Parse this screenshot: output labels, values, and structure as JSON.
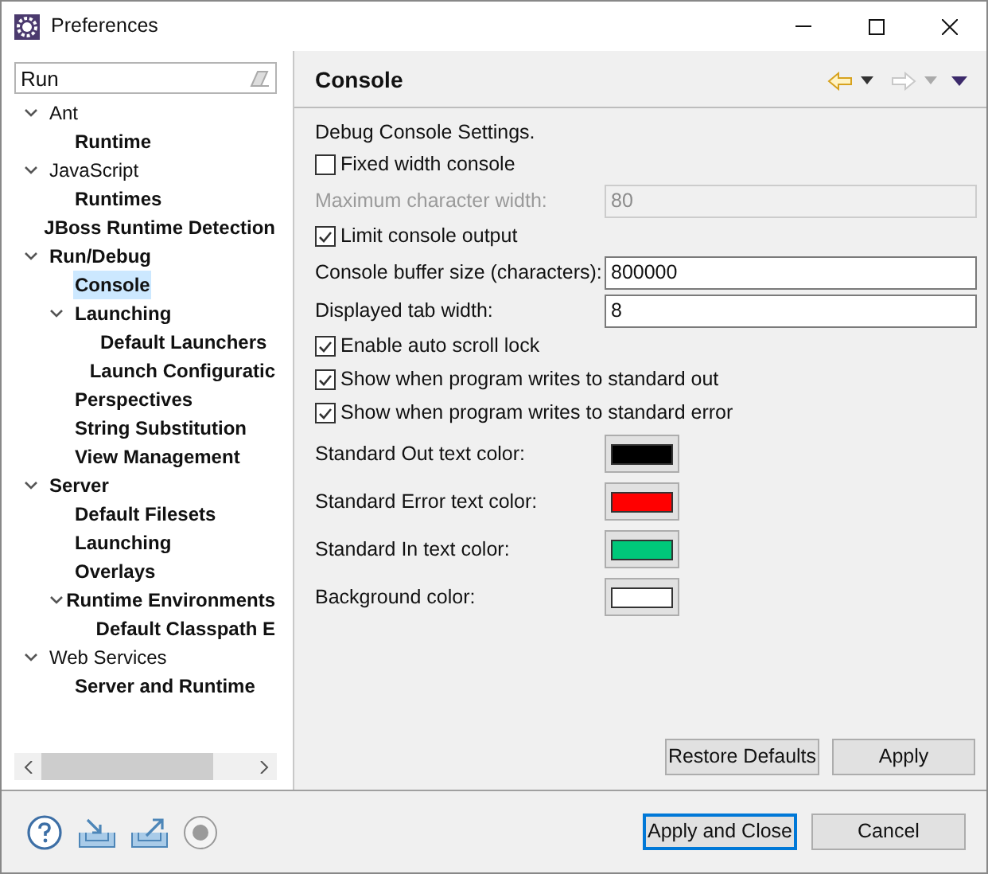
{
  "window": {
    "title": "Preferences"
  },
  "filter": {
    "value": "Run"
  },
  "tree": [
    {
      "label": "Ant",
      "matched": false,
      "selected": false,
      "expanded": true,
      "children": [
        {
          "label": "Runtime",
          "matched": true,
          "selected": false
        }
      ]
    },
    {
      "label": "JavaScript",
      "matched": false,
      "selected": false,
      "expanded": true,
      "children": [
        {
          "label": "Runtimes",
          "matched": true,
          "selected": false
        }
      ]
    },
    {
      "label": "JBoss Runtime Detection",
      "matched": true,
      "selected": false
    },
    {
      "label": "Run/Debug",
      "matched": true,
      "selected": false,
      "expanded": true,
      "children": [
        {
          "label": "Console",
          "matched": true,
          "selected": true
        },
        {
          "label": "Launching",
          "matched": true,
          "selected": false,
          "expanded": true,
          "children": [
            {
              "label": "Default Launchers",
              "matched": true,
              "selected": false
            },
            {
              "label": "Launch Configuratic",
              "matched": true,
              "selected": false
            }
          ]
        },
        {
          "label": "Perspectives",
          "matched": true,
          "selected": false
        },
        {
          "label": "String Substitution",
          "matched": true,
          "selected": false
        },
        {
          "label": "View Management",
          "matched": true,
          "selected": false
        }
      ]
    },
    {
      "label": "Server",
      "matched": true,
      "selected": false,
      "expanded": true,
      "children": [
        {
          "label": "Default Filesets",
          "matched": true,
          "selected": false
        },
        {
          "label": "Launching",
          "matched": true,
          "selected": false
        },
        {
          "label": "Overlays",
          "matched": true,
          "selected": false
        },
        {
          "label": "Runtime Environments",
          "matched": true,
          "selected": false,
          "expanded": true,
          "children": [
            {
              "label": "Default Classpath E",
              "matched": true,
              "selected": false
            }
          ]
        }
      ]
    },
    {
      "label": "Web Services",
      "matched": false,
      "selected": false,
      "expanded": true,
      "children": [
        {
          "label": "Server and Runtime",
          "matched": true,
          "selected": false
        }
      ]
    }
  ],
  "page": {
    "title": "Console",
    "description": "Debug Console Settings.",
    "settings": [
      {
        "kind": "checkbox",
        "label": "Fixed width console",
        "checked": false
      },
      {
        "kind": "field",
        "label": "Maximum character width:",
        "value": "80",
        "disabled": true
      },
      {
        "kind": "checkbox",
        "label": "Limit console output",
        "checked": true
      },
      {
        "kind": "field",
        "label": "Console buffer size (characters):",
        "value": "800000",
        "disabled": false
      },
      {
        "kind": "field",
        "label": "Displayed tab width:",
        "value": "8",
        "disabled": false
      },
      {
        "kind": "checkbox",
        "label": "Enable auto scroll lock",
        "checked": true
      },
      {
        "kind": "checkbox",
        "label": "Show when program writes to standard out",
        "checked": true
      },
      {
        "kind": "checkbox",
        "label": "Show when program writes to standard error",
        "checked": true
      },
      {
        "kind": "color",
        "label": "Standard Out text color:",
        "color": "#000000"
      },
      {
        "kind": "color",
        "label": "Standard Error text color:",
        "color": "#ff0000"
      },
      {
        "kind": "color",
        "label": "Standard In text color:",
        "color": "#00c87a"
      },
      {
        "kind": "color",
        "label": "Background color:",
        "color": "#ffffff"
      }
    ],
    "buttons": [
      "Restore Defaults",
      "Apply"
    ]
  },
  "footer_buttons": [
    {
      "label": "Apply and Close",
      "default": true
    },
    {
      "label": "Cancel",
      "default": false
    }
  ]
}
